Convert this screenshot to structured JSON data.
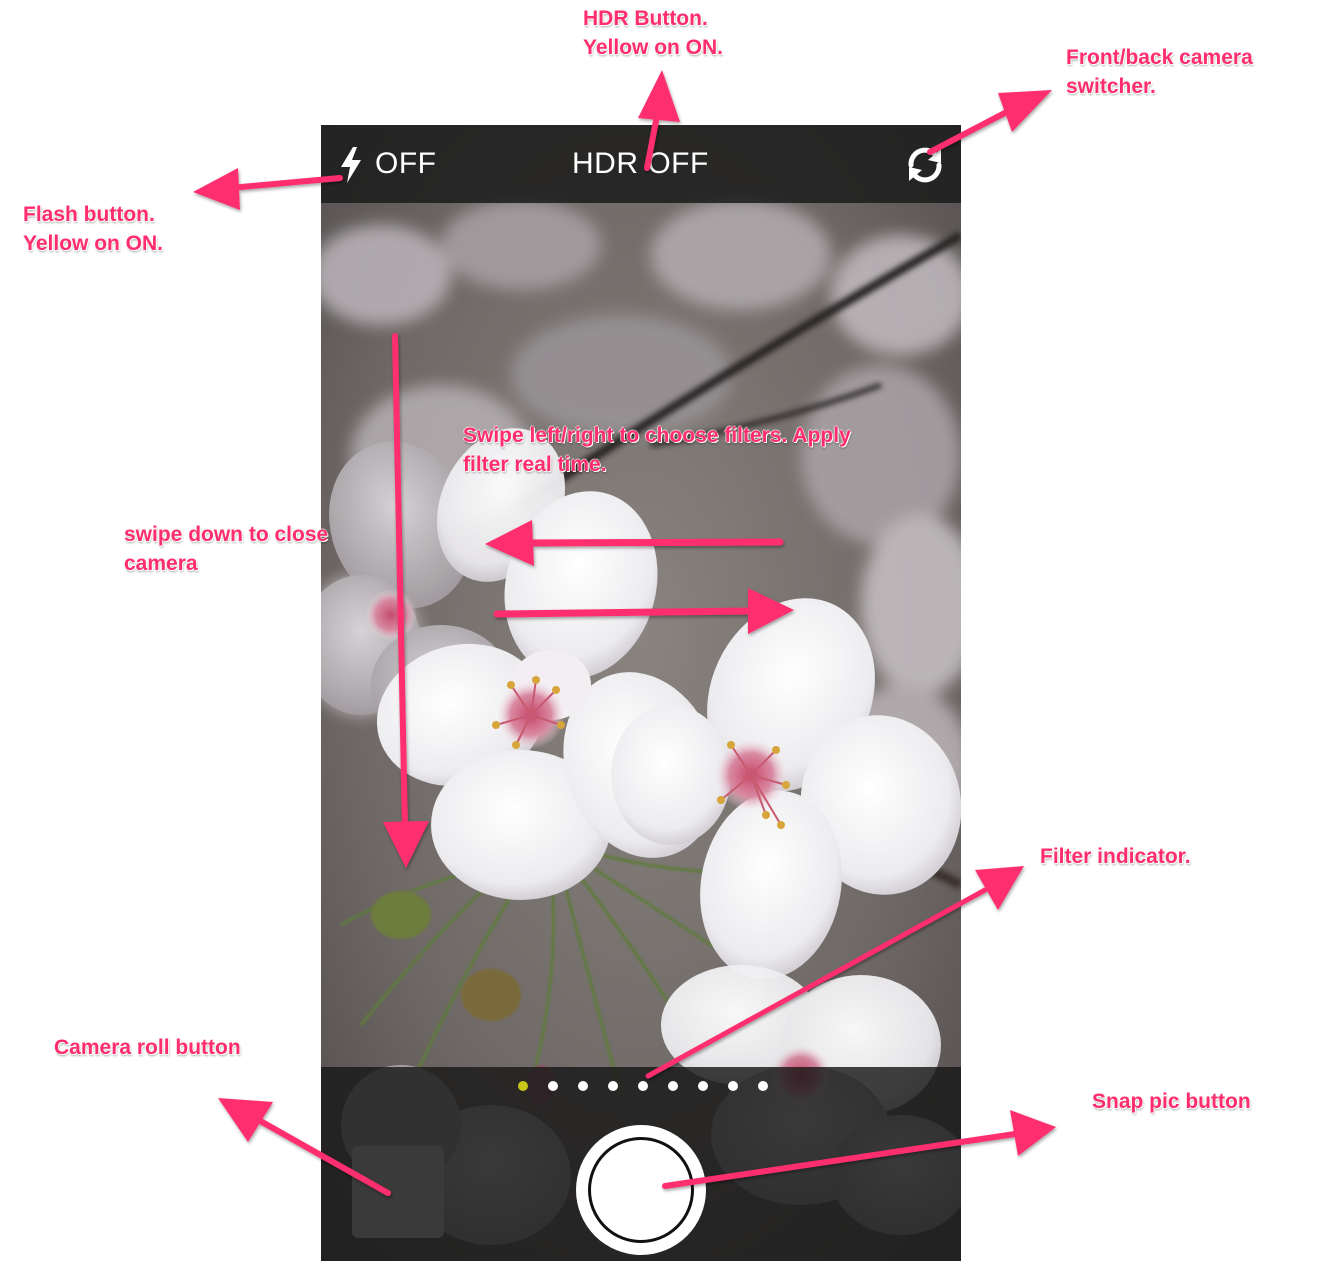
{
  "top_bar": {
    "flash_label": "OFF",
    "hdr_label": "HDR OFF",
    "flash_icon": "lightning-bolt",
    "switch_icon": "rotate-arrows"
  },
  "filter_indicator": {
    "count": 9,
    "active_index": 0,
    "active_color": "#c9c617",
    "inactive_color": "#ffffff"
  },
  "annotations": {
    "hdr": [
      "HDR Button.",
      "Yellow on ON."
    ],
    "switcher": [
      "Front/back camera",
      "switcher."
    ],
    "flash": [
      "Flash button.",
      "Yellow on ON."
    ],
    "swipe_filters": [
      "Swipe left/right to choose filters. Apply",
      "filter real time."
    ],
    "swipe_down": [
      "swipe down to close",
      "camera"
    ],
    "filter_indicator": [
      "Filter indicator."
    ],
    "camera_roll": [
      "Camera roll button"
    ],
    "snap": [
      "Snap pic button"
    ]
  },
  "colors": {
    "annotation": "#ff2d6e",
    "bar_background": "#1c1c1c"
  }
}
